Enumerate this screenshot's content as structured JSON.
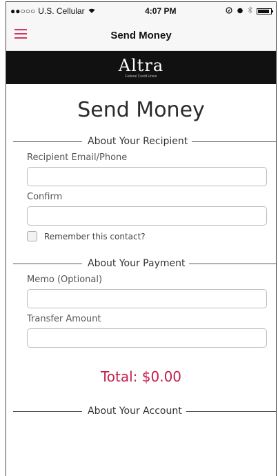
{
  "status_bar": {
    "carrier": "U.S. Cellular",
    "signal_icon": "signal-dots-icon",
    "wifi_icon": "wifi-icon",
    "time": "4:07 PM",
    "right_icons": [
      "location-icon",
      "alarm-icon",
      "bluetooth-icon",
      "battery-icon"
    ]
  },
  "navbar": {
    "menu_icon": "hamburger-menu-icon",
    "title": "Send Money"
  },
  "brand": {
    "logo_text": "Altra",
    "logo_subtext": "Federal Credit Union"
  },
  "page": {
    "title": "Send Money"
  },
  "recipient_section": {
    "header": "About Your Recipient",
    "email_label": "Recipient Email/Phone",
    "email_value": "",
    "confirm_label": "Confirm",
    "confirm_value": "",
    "remember_label": "Remember this contact?",
    "remember_checked": false
  },
  "payment_section": {
    "header": "About Your Payment",
    "memo_label": "Memo (Optional)",
    "memo_value": "",
    "amount_label": "Transfer Amount",
    "amount_value": ""
  },
  "total": {
    "text": "Total: $0.00"
  },
  "account_section": {
    "header": "About Your Account"
  },
  "colors": {
    "accent": "#c41e4b",
    "menu_icon": "#d4365f",
    "brand_bar": "#111111"
  }
}
